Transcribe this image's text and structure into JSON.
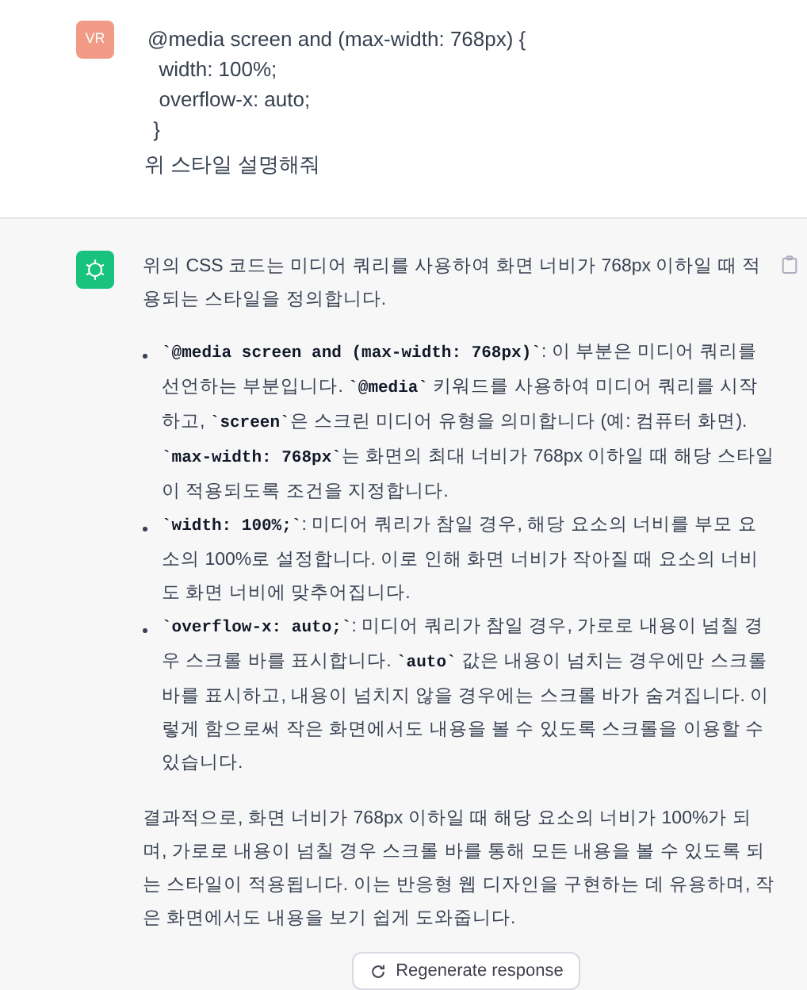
{
  "user_message": {
    "avatar": "VR",
    "code_lines": [
      "@media screen and (max-width: 768px) {",
      "  width: 100%;",
      "  overflow-x: auto;",
      " }"
    ],
    "text": "위 스타일 설명해줘"
  },
  "assistant_message": {
    "intro": "위의 CSS 코드는 미디어 쿼리를 사용하여 화면 너비가 768px 이하일 때 적용되는 스타일을 정의합니다.",
    "bullets": [
      [
        {
          "kind": "code",
          "text": "`@media screen and (max-width: 768px)`"
        },
        {
          "kind": "text",
          "text": ": 이 부분은 미디어 쿼리를 선언하는 부분입니다. "
        },
        {
          "kind": "code",
          "text": "`@media`"
        },
        {
          "kind": "text",
          "text": " 키워드를 사용하여 미디어 쿼리를 시작하고, "
        },
        {
          "kind": "code",
          "text": "`screen`"
        },
        {
          "kind": "text",
          "text": "은 스크린 미디어 유형을 의미합니다 (예: 컴퓨터 화면). "
        },
        {
          "kind": "code",
          "text": "`max-width: 768px`"
        },
        {
          "kind": "text",
          "text": "는 화면의 최대 너비가 768px 이하일 때 해당 스타일이 적용되도록 조건을 지정합니다."
        }
      ],
      [
        {
          "kind": "code",
          "text": "`width: 100%;`"
        },
        {
          "kind": "text",
          "text": ": 미디어 쿼리가 참일 경우, 해당 요소의 너비를 부모 요소의 100%로 설정합니다. 이로 인해 화면 너비가 작아질 때 요소의 너비도 화면 너비에 맞추어집니다."
        }
      ],
      [
        {
          "kind": "code",
          "text": "`overflow-x: auto;`"
        },
        {
          "kind": "text",
          "text": ": 미디어 쿼리가 참일 경우, 가로로 내용이 넘칠 경우 스크롤 바를 표시합니다. "
        },
        {
          "kind": "code",
          "text": "`auto`"
        },
        {
          "kind": "text",
          "text": " 값은 내용이 넘치는 경우에만 스크롤 바를 표시하고, 내용이 넘치지 않을 경우에는 스크롤 바가 숨겨집니다. 이렇게 함으로써 작은 화면에서도 내용을 볼 수 있도록 스크롤을 이용할 수 있습니다."
        }
      ]
    ],
    "conclusion": "결과적으로, 화면 너비가 768px 이하일 때 해당 요소의 너비가 100%가 되며, 가로로 내용이 넘칠 경우 스크롤 바를 통해 모든 내용을 볼 수 있도록 되는 스타일이 적용됩니다. 이는 반응형 웹 디자인을 구현하는 데 유용하며, 작은 화면에서도 내용을 보기 쉽게 도와줍니다."
  },
  "regenerate_button": "Regenerate response"
}
